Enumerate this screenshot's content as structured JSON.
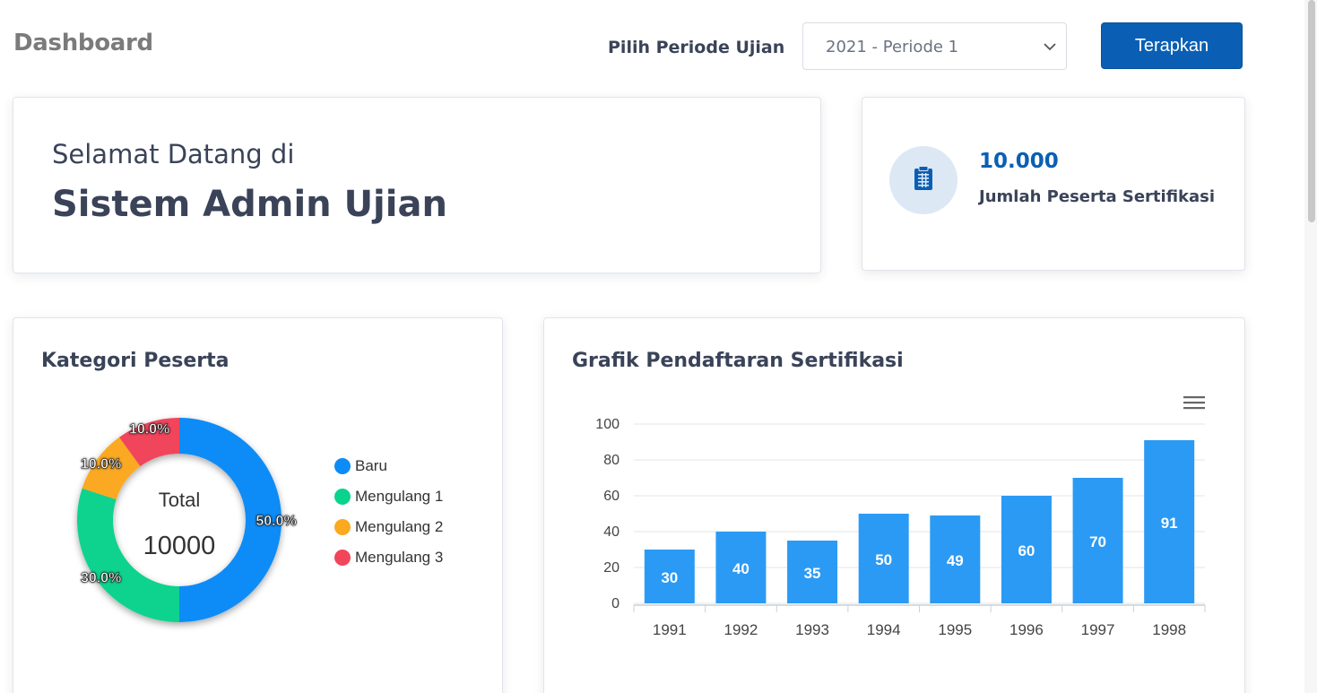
{
  "header": {
    "title": "Dashboard",
    "period_label": "Pilih Periode Ujian",
    "period_value": "2021 - Periode 1",
    "apply_label": "Terapkan"
  },
  "welcome": {
    "line1": "Selamat Datang di",
    "line2": "Sistem Admin Ujian"
  },
  "stat": {
    "value": "10.000",
    "label": "Jumlah Peserta Sertifikasi",
    "icon": "clipboard-icon"
  },
  "category_card": {
    "title": "Kategori Peserta",
    "center_label": "Total",
    "center_value": "10000"
  },
  "registration_card": {
    "title": "Grafik Pendaftaran Sertifikasi",
    "menu_icon": "hamburger-menu-icon"
  },
  "colors": {
    "primary": "#0a5fb4",
    "bar": "#2b9af5",
    "baru": "#0d8cf7",
    "mengulang1": "#0ad38e",
    "mengulang2": "#fba921",
    "mengulang3": "#f1455b"
  },
  "chart_data": [
    {
      "type": "pie",
      "categories": [
        "Baru",
        "Mengulang 1",
        "Mengulang 2",
        "Mengulang 3"
      ],
      "values": [
        50.0,
        30.0,
        10.0,
        10.0
      ],
      "labels": [
        "50.0%",
        "30.0%",
        "10.0%",
        "10.0%"
      ],
      "colors": [
        "#0d8cf7",
        "#0ad38e",
        "#fba921",
        "#f1455b"
      ],
      "legend_position": "right"
    },
    {
      "type": "bar",
      "categories": [
        "1991",
        "1992",
        "1993",
        "1994",
        "1995",
        "1996",
        "1997",
        "1998"
      ],
      "values": [
        30,
        40,
        35,
        50,
        49,
        60,
        70,
        91
      ],
      "yticks": [
        0,
        20,
        40,
        60,
        80,
        100
      ],
      "ylim": [
        0,
        100
      ],
      "grid": true,
      "data_labels": true,
      "color": "#2b9af5"
    }
  ]
}
